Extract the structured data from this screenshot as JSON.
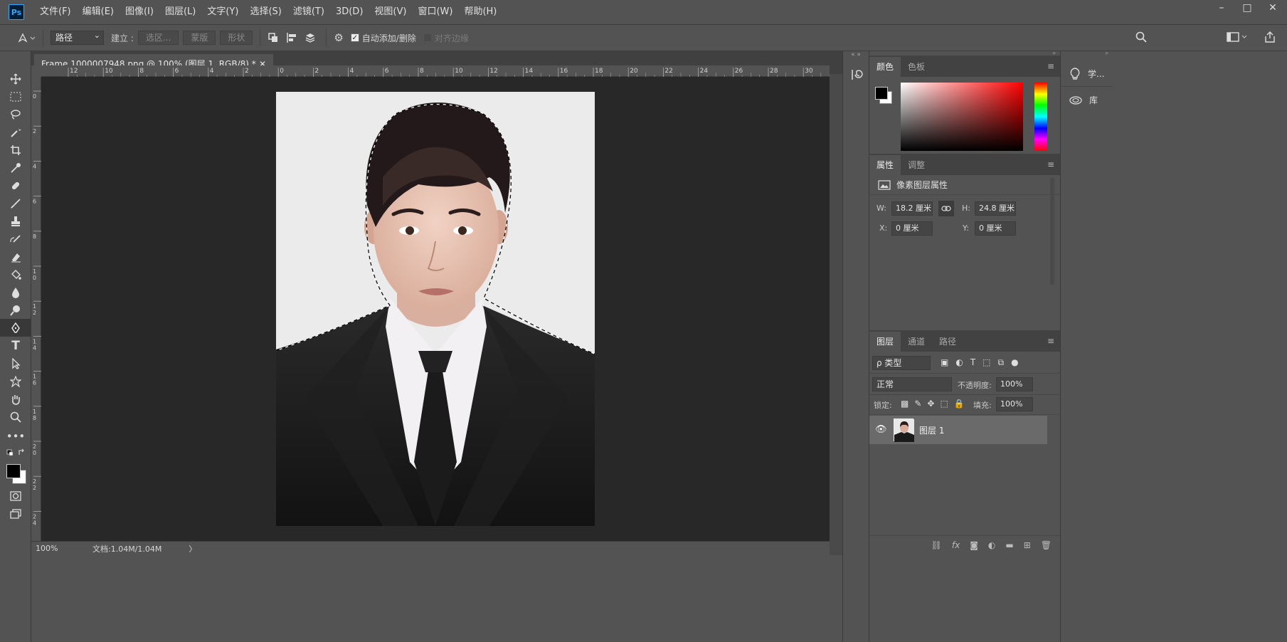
{
  "app": {
    "logo": "Ps"
  },
  "menu": [
    "文件(F)",
    "编辑(E)",
    "图像(I)",
    "图层(L)",
    "文字(Y)",
    "选择(S)",
    "滤镜(T)",
    "3D(D)",
    "视图(V)",
    "窗口(W)",
    "帮助(H)"
  ],
  "window_controls": {
    "minimize": "–",
    "maximize": "□",
    "close": "✕"
  },
  "options": {
    "mode_select": "路径",
    "make_label": "建立 :",
    "selection_btn": "选区...",
    "mask_btn": "蒙版",
    "shape_btn": "形状",
    "auto_add_delete": "自动添加/删除",
    "align_edges": "对齐边缘"
  },
  "document": {
    "tab_title": "Frame 1000007948.png @ 100% (图层 1, RGB/8) *",
    "close_glyph": "✕",
    "ruler_top": [
      "12",
      "10",
      "8",
      "6",
      "4",
      "2",
      "0",
      "2",
      "4",
      "6",
      "8",
      "10",
      "12",
      "14",
      "16",
      "18",
      "20",
      "22",
      "24",
      "26",
      "28",
      "30"
    ],
    "ruler_left": [
      "0",
      "2",
      "4",
      "6",
      "8",
      "1\n0",
      "1\n2",
      "1\n4",
      "1\n6",
      "1\n8",
      "2\n0",
      "2\n2",
      "2\n4"
    ],
    "zoom": "100%",
    "doc_size": "文档:1.04M/1.04M",
    "status_arrow": "〉"
  },
  "color_panel": {
    "tabs": [
      "颜色",
      "色板"
    ]
  },
  "properties_panel": {
    "tabs": [
      "属性",
      "调整"
    ],
    "title": "像素图层属性",
    "w_label": "W:",
    "w_value": "18.2 厘米",
    "h_label": "H:",
    "h_value": "24.8 厘米",
    "x_label": "X:",
    "x_value": "0 厘米",
    "y_label": "Y:",
    "y_value": "0 厘米"
  },
  "layers_panel": {
    "tabs": [
      "图层",
      "通道",
      "路径"
    ],
    "filter_type": "ρ 类型",
    "blend_mode": "正常",
    "opacity_label": "不透明度:",
    "opacity_value": "100%",
    "lock_label": "锁定:",
    "fill_label": "填充:",
    "fill_value": "100%",
    "layers": [
      {
        "name": "图层 1",
        "visible": true
      }
    ]
  },
  "side_panels": {
    "learn": "学...",
    "libraries": "库"
  },
  "colors": {
    "accent": "#31a8ff",
    "bg": "#535353",
    "canvas": "#282828"
  }
}
